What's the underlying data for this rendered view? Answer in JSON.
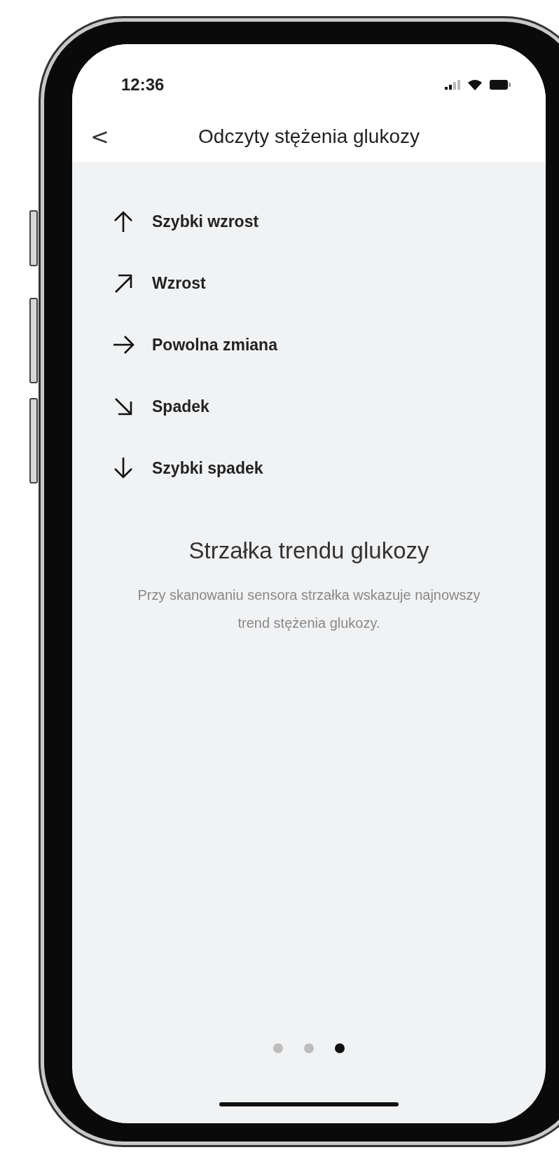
{
  "status_bar": {
    "time": "12:36"
  },
  "nav": {
    "back": "<",
    "title": "Odczyty stężenia glukozy"
  },
  "trends": [
    {
      "kind": "up",
      "label": "Szybki wzrost"
    },
    {
      "kind": "up-right",
      "label": "Wzrost"
    },
    {
      "kind": "right",
      "label": "Powolna zmiana"
    },
    {
      "kind": "down-right",
      "label": "Spadek"
    },
    {
      "kind": "down",
      "label": "Szybki spadek"
    }
  ],
  "heading": "Strzałka trendu glukozy",
  "description": "Przy skanowaniu sensora strzałka wskazuje najnowszy trend stężenia glukozy.",
  "pages": [
    {
      "selected": false
    },
    {
      "selected": false
    },
    {
      "selected": true
    }
  ]
}
